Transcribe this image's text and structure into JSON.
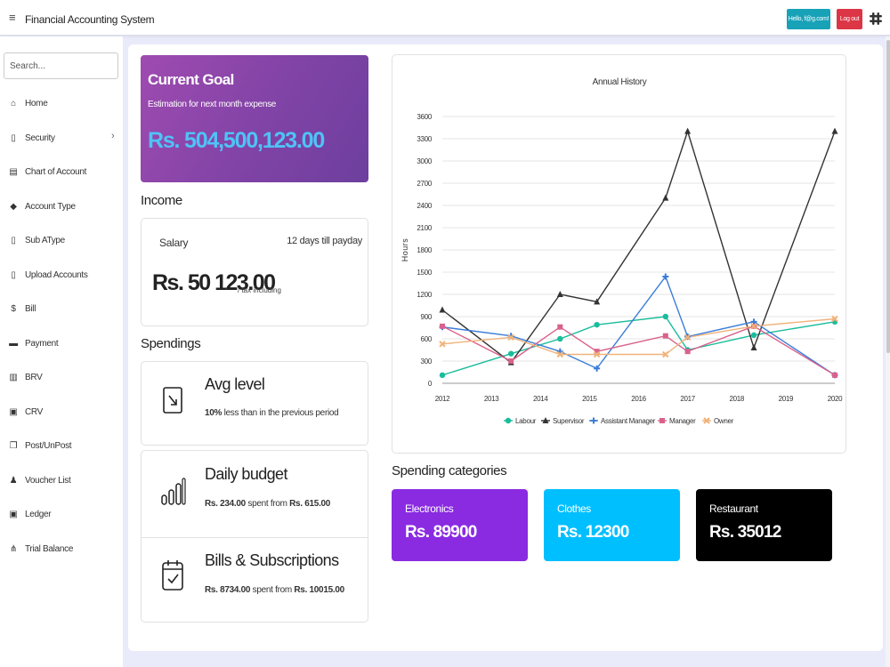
{
  "header": {
    "menu_icon": "hamburger-icon",
    "title": "Financial Accounting System",
    "hello_label": "Hello, f@g.com!",
    "logout_label": "Log out",
    "brand_icon": "slack-icon"
  },
  "sidebar": {
    "search_placeholder": "Search...",
    "items": [
      {
        "label": "Home",
        "icon": "home-icon",
        "glyph": "⌂"
      },
      {
        "label": "Security",
        "icon": "document-lock-icon",
        "glyph": "▯",
        "chevron": "›"
      },
      {
        "label": "Chart of Account",
        "icon": "list-icon",
        "glyph": "▤"
      },
      {
        "label": "Account Type",
        "icon": "diamond-grid-icon",
        "glyph": "◆"
      },
      {
        "label": "Sub AType",
        "icon": "document-e-icon",
        "glyph": "▯"
      },
      {
        "label": "Upload Accounts",
        "icon": "clipboard-icon",
        "glyph": "▯"
      },
      {
        "label": "Bill",
        "icon": "dollar-icon",
        "glyph": "$"
      },
      {
        "label": "Payment",
        "icon": "wallet-icon",
        "glyph": "▬"
      },
      {
        "label": "BRV",
        "icon": "bank-icon",
        "glyph": "▥"
      },
      {
        "label": "CRV",
        "icon": "calendar-icon",
        "glyph": "▣"
      },
      {
        "label": "Post/UnPost",
        "icon": "copy-icon",
        "glyph": "❐"
      },
      {
        "label": "Voucher List",
        "icon": "users-icon",
        "glyph": "♟"
      },
      {
        "label": "Ledger",
        "icon": "calendar-check-icon",
        "glyph": "▣"
      },
      {
        "label": "Trial Balance",
        "icon": "sitemap-icon",
        "glyph": "⋔"
      }
    ]
  },
  "goal": {
    "title": "Current Goal",
    "subtitle": "Estimation for next month expense",
    "amount": "Rs. 504,500,123.00",
    "gradient": [
      "#9f4bb0",
      "#6d3f9e"
    ],
    "amount_color": "#4fc3f7"
  },
  "income": {
    "section_title": "Income",
    "label": "Salary",
    "payday": "12 days till payday",
    "amount": "Rs. 50 123.00",
    "note": "/ tax including"
  },
  "spendings": {
    "section_title": "Spendings",
    "items": [
      {
        "icon": "arrow-down-right-icon",
        "title": "Avg level",
        "bold1": "10%",
        "text1": " less than in the previous period",
        "bold2": "",
        "text2": "",
        "text3": ""
      },
      {
        "icon": "bar-chart-icon",
        "title": "Daily budget",
        "bold1": "Rs. 234.00",
        "text1": " spent from ",
        "bold2": "Rs. 615.00",
        "text2": "",
        "text3": ""
      },
      {
        "icon": "calendar-check-icon",
        "title": "Bills & Subscriptions",
        "bold1": "Rs. 8734.00",
        "text1": " spent from ",
        "bold2": "Rs. 10015.00",
        "text2": "",
        "text3": ""
      }
    ]
  },
  "categories": {
    "section_title": "Spending categories",
    "items": [
      {
        "name": "Electronics",
        "amount": "Rs. 89900",
        "color": "#8a2be2"
      },
      {
        "name": "Clothes",
        "amount": "Rs. 12300",
        "color": "#00bfff"
      },
      {
        "name": "Restaurant",
        "amount": "Rs. 35012",
        "color": "#000000"
      }
    ]
  },
  "chart_data": {
    "type": "line",
    "title": "Annual History",
    "xlabel": "",
    "ylabel": "Hours",
    "x_ticks": [
      2012,
      2013,
      2014,
      2015,
      2016,
      2017,
      2018,
      2019,
      2020
    ],
    "xlim": [
      2012,
      2020
    ],
    "ylim": [
      0,
      3600
    ],
    "y_ticks": [
      0,
      300,
      600,
      900,
      1200,
      1500,
      1800,
      2100,
      2400,
      2700,
      3000,
      3300,
      3600
    ],
    "grid": true,
    "legend_position": "bottom",
    "series": [
      {
        "name": "Labour",
        "color": "#1abc9c",
        "marker": "circle",
        "points": [
          [
            2012,
            110
          ],
          [
            2013.4,
            400
          ],
          [
            2014.4,
            600
          ],
          [
            2015.15,
            790
          ],
          [
            2016.55,
            900
          ],
          [
            2017,
            450
          ],
          [
            2018.35,
            650
          ],
          [
            2020,
            830
          ]
        ]
      },
      {
        "name": "Supervisor",
        "color": "#333333",
        "marker": "triangle",
        "points": [
          [
            2012,
            990
          ],
          [
            2013.4,
            280
          ],
          [
            2014.4,
            1200
          ],
          [
            2015.15,
            1100
          ],
          [
            2016.55,
            2500
          ],
          [
            2017,
            3400
          ],
          [
            2018.35,
            480
          ],
          [
            2020,
            3400
          ]
        ]
      },
      {
        "name": "Assistant Manager",
        "color": "#3b7dd8",
        "marker": "cross",
        "points": [
          [
            2012,
            760
          ],
          [
            2013.4,
            640
          ],
          [
            2014.4,
            430
          ],
          [
            2015.15,
            200
          ],
          [
            2016.55,
            1440
          ],
          [
            2017,
            630
          ],
          [
            2018.35,
            830
          ],
          [
            2020,
            110
          ]
        ]
      },
      {
        "name": "Manager",
        "color": "#d9628c",
        "marker": "square",
        "points": [
          [
            2012,
            770
          ],
          [
            2013.4,
            300
          ],
          [
            2014.4,
            760
          ],
          [
            2015.15,
            430
          ],
          [
            2016.55,
            640
          ],
          [
            2017,
            430
          ],
          [
            2018.35,
            770
          ],
          [
            2020,
            110
          ]
        ]
      },
      {
        "name": "Owner",
        "color": "#f0b27a",
        "marker": "x",
        "points": [
          [
            2012,
            530
          ],
          [
            2013.4,
            620
          ],
          [
            2014.4,
            390
          ],
          [
            2015.15,
            390
          ],
          [
            2016.55,
            390
          ],
          [
            2017,
            620
          ],
          [
            2018.35,
            770
          ],
          [
            2020,
            870
          ]
        ]
      }
    ]
  }
}
